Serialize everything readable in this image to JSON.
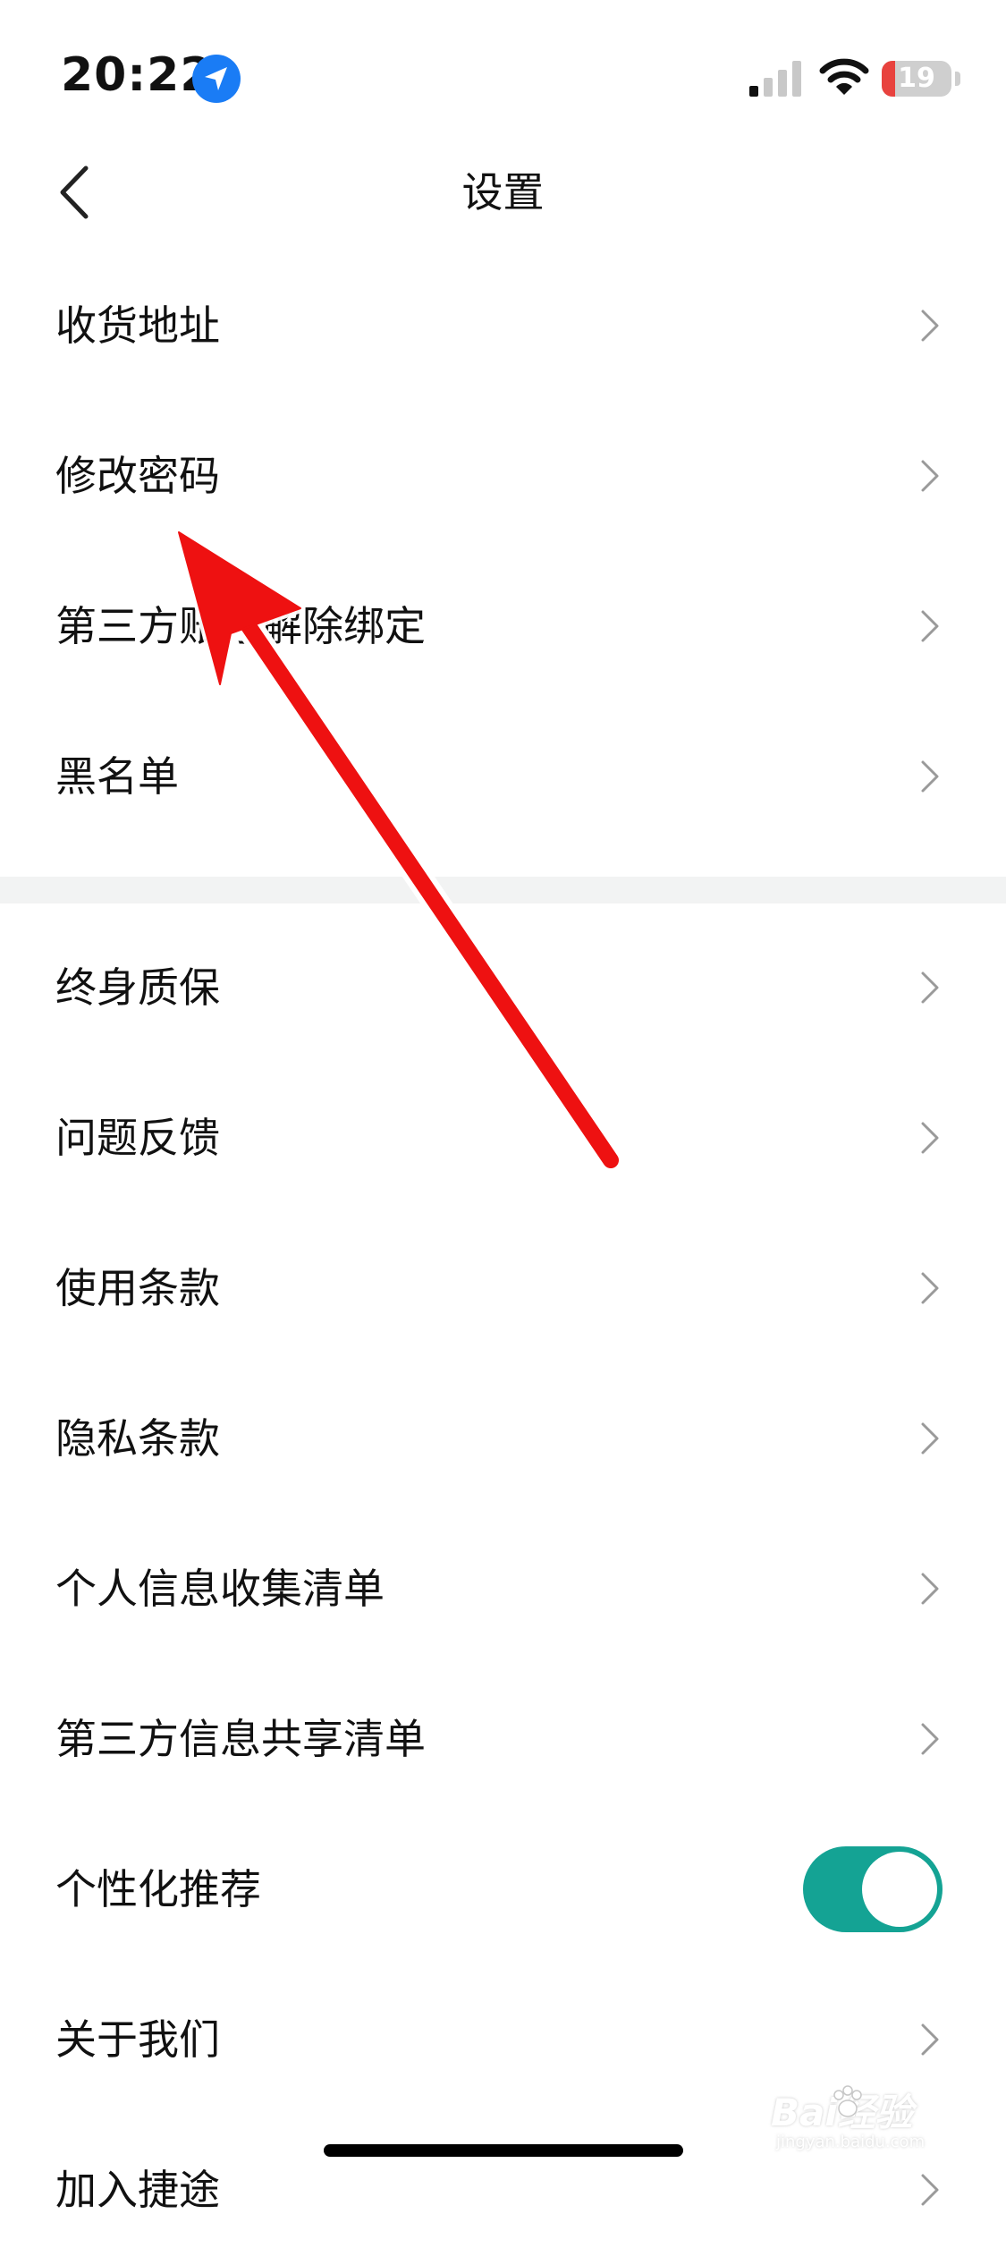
{
  "status_bar": {
    "time": "20:22",
    "battery_level": "19",
    "location_icon": "location-arrow-icon",
    "signal_icon": "cellular-signal-icon",
    "wifi_icon": "wifi-icon",
    "colors": {
      "battery_low": "#e8423e",
      "location": "#1a7cf5"
    }
  },
  "nav": {
    "back_icon": "chevron-left-icon",
    "title": "设置"
  },
  "menu": {
    "group1": [
      {
        "label": "收货地址"
      },
      {
        "label": "修改密码"
      },
      {
        "label": "第三方账号解除绑定"
      },
      {
        "label": "黑名单"
      }
    ],
    "group2": [
      {
        "label": "终身质保"
      },
      {
        "label": "问题反馈"
      },
      {
        "label": "使用条款"
      },
      {
        "label": "隐私条款"
      },
      {
        "label": "个人信息收集清单"
      },
      {
        "label": "第三方信息共享清单"
      },
      {
        "label": "个性化推荐",
        "toggle_on": true
      },
      {
        "label": "关于我们"
      },
      {
        "label": "加入捷途"
      }
    ],
    "chevron_icon": "chevron-right-icon",
    "toggle_color": "#14a394"
  },
  "annotation": {
    "arrow_color": "#ee1111"
  },
  "watermark": {
    "logo": "Bai经验",
    "sub": "jingyan.baidu.com"
  }
}
